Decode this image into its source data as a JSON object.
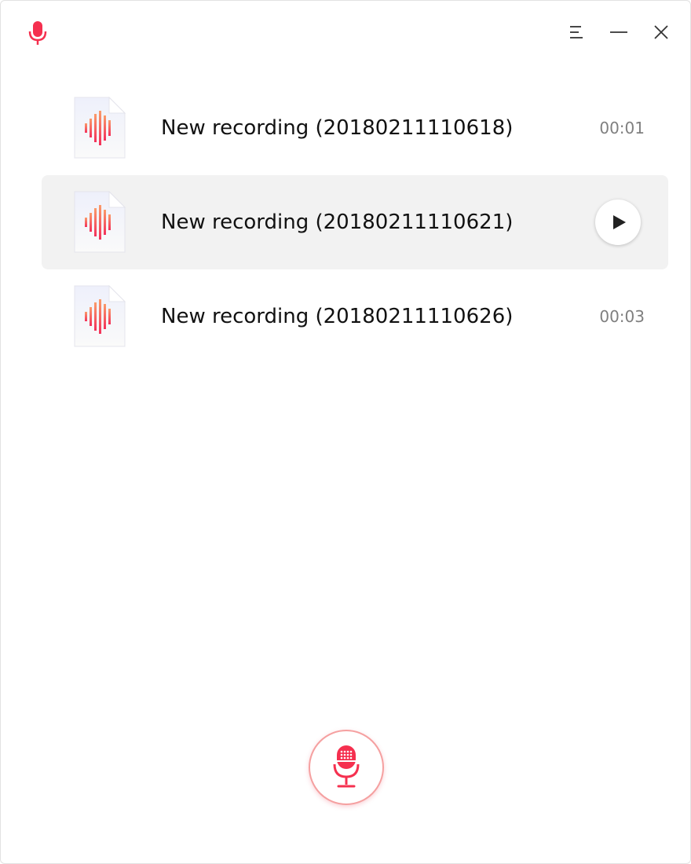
{
  "window": {
    "menu_icon": "hamburger-menu-icon",
    "minimize_icon": "minimize-icon",
    "close_icon": "close-icon",
    "app_icon": "microphone-icon"
  },
  "recordings": [
    {
      "name": "New recording (20180211110618)",
      "duration": "00:01",
      "selected": false
    },
    {
      "name": "New recording (20180211110621)",
      "duration": "",
      "selected": true
    },
    {
      "name": "New recording (20180211110626)",
      "duration": "00:03",
      "selected": false
    }
  ],
  "record_button": {
    "icon": "microphone-icon"
  },
  "colors": {
    "accent": "#f5304f",
    "accent_light": "#f8a3a3",
    "selected_row": "#f2f2f2",
    "duration_text": "#7f7f7f"
  }
}
